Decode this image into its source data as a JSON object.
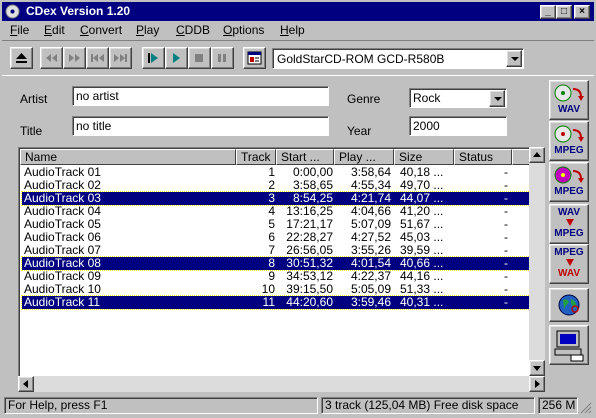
{
  "window": {
    "title": "CDex Version 1.20",
    "buttons": {
      "minimize": "_",
      "maximize": "□",
      "close": "×"
    }
  },
  "menu": [
    "File",
    "Edit",
    "Convert",
    "Play",
    "CDDB",
    "Options",
    "Help"
  ],
  "toolbar": {
    "drive": "GoldStarCD-ROM GCD-R580B",
    "icons": [
      "eject-icon",
      "prev-track-icon",
      "next-track-icon",
      "skip-back-icon",
      "skip-forward-icon",
      "play-icon",
      "play-selection-icon",
      "stop-icon",
      "pause-icon",
      "cd-info-icon"
    ]
  },
  "form": {
    "artist_label": "Artist",
    "artist_value": "no artist",
    "title_label": "Title",
    "title_value": "no title",
    "genre_label": "Genre",
    "genre_value": "Rock",
    "year_label": "Year",
    "year_value": "2000"
  },
  "tracklist": {
    "columns": [
      "Name",
      "Track",
      "Start ...",
      "Play ...",
      "Size",
      "Status"
    ],
    "rows": [
      {
        "name": "AudioTrack 01",
        "track": "1",
        "start": "0:00,00",
        "play": "3:58,64",
        "size": "40,18 ...",
        "status": "-",
        "selected": false
      },
      {
        "name": "AudioTrack 02",
        "track": "2",
        "start": "3:58,65",
        "play": "4:55,34",
        "size": "49,70 ...",
        "status": "-",
        "selected": false
      },
      {
        "name": "AudioTrack 03",
        "track": "3",
        "start": "8:54,25",
        "play": "4:21,74",
        "size": "44,07 ...",
        "status": "-",
        "selected": true
      },
      {
        "name": "AudioTrack 04",
        "track": "4",
        "start": "13:16,25",
        "play": "4:04,66",
        "size": "41,20 ...",
        "status": "-",
        "selected": false
      },
      {
        "name": "AudioTrack 05",
        "track": "5",
        "start": "17:21,17",
        "play": "5:07,09",
        "size": "51,67 ...",
        "status": "-",
        "selected": false
      },
      {
        "name": "AudioTrack 06",
        "track": "6",
        "start": "22:28,27",
        "play": "4:27,52",
        "size": "45,03 ...",
        "status": "-",
        "selected": false
      },
      {
        "name": "AudioTrack 07",
        "track": "7",
        "start": "26:56,05",
        "play": "3:55,26",
        "size": "39,59 ...",
        "status": "-",
        "selected": false
      },
      {
        "name": "AudioTrack 08",
        "track": "8",
        "start": "30:51,32",
        "play": "4:01,54",
        "size": "40,66 ...",
        "status": "-",
        "selected": true
      },
      {
        "name": "AudioTrack 09",
        "track": "9",
        "start": "34:53,12",
        "play": "4:22,37",
        "size": "44,16 ...",
        "status": "-",
        "selected": false
      },
      {
        "name": "AudioTrack 10",
        "track": "10",
        "start": "39:15,50",
        "play": "5:05,09",
        "size": "51,33 ...",
        "status": "-",
        "selected": false
      },
      {
        "name": "AudioTrack 11",
        "track": "11",
        "start": "44:20,60",
        "play": "3:59,46",
        "size": "40,31 ...",
        "status": "-",
        "selected": true
      }
    ]
  },
  "sidebar": {
    "buttons": [
      {
        "label": "WAV",
        "icon": "cd-to-wav-icon"
      },
      {
        "label": "MPEG",
        "icon": "cd-to-mpeg-icon"
      },
      {
        "label": "MPEG",
        "icon": "cd-to-mpeg-direct-icon"
      },
      {
        "label_top": "WAV",
        "label_bottom": "MPEG",
        "icon": "wav-to-mpeg-icon"
      },
      {
        "label_top": "MPEG",
        "label_bottom": "WAV",
        "icon": "mpeg-to-wav-icon"
      },
      {
        "icon": "cddb-globe-icon"
      },
      {
        "icon": "configure-computer-icon"
      }
    ]
  },
  "status": {
    "help": "For Help, press F1",
    "tracks": "3 track (125,04 MB) Free disk space",
    "free": "256 M"
  },
  "colors": {
    "titlebar": "#000080",
    "selection": "#000080",
    "face": "#c0c0c0"
  }
}
